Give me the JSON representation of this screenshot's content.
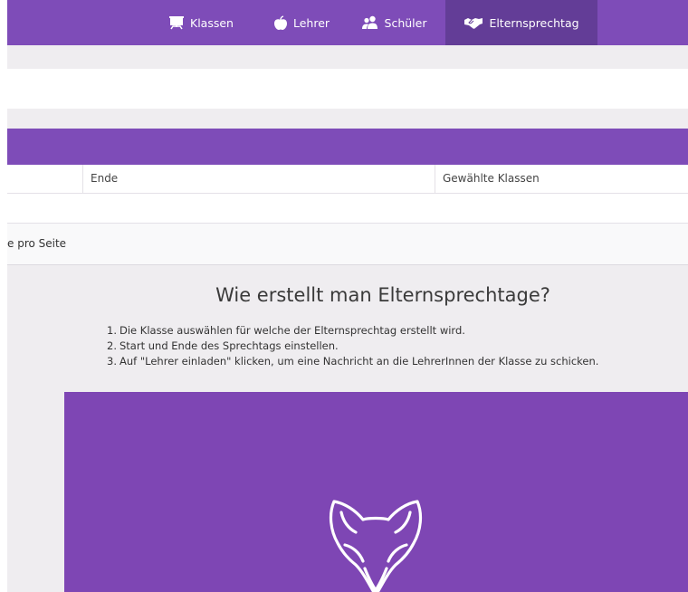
{
  "nav": {
    "items": [
      {
        "label": "Klassen",
        "icon": "presentation-board-icon",
        "active": false
      },
      {
        "label": "Lehrer",
        "icon": "apple-icon",
        "active": false
      },
      {
        "label": "Schüler",
        "icon": "users-icon",
        "active": false
      },
      {
        "label": "Elternsprechtag",
        "icon": "handshake-icon",
        "active": true
      }
    ]
  },
  "table": {
    "columns": [
      "Ende",
      "Gewählte Klassen"
    ],
    "per_page_text": "e pro Seite"
  },
  "help": {
    "title": "Wie erstellt man Elternsprechtage?",
    "steps": [
      {
        "num": "1.",
        "text": "Die Klasse auswählen für welche der Elternsprechtag erstellt wird."
      },
      {
        "num": "2.",
        "text": "Start und Ende des Sprechtags einstellen."
      },
      {
        "num": "3.",
        "text": "Auf \"Lehrer einladen\" klicken, um eine Nachricht an die LehrerInnen der Klasse zu schicken."
      }
    ]
  },
  "colors": {
    "brand_purple": "#7e4cb8",
    "nav_active": "#633d97",
    "illustration_bg": "#7e46b4"
  },
  "illustration": {
    "icon": "fox-logo-icon"
  }
}
